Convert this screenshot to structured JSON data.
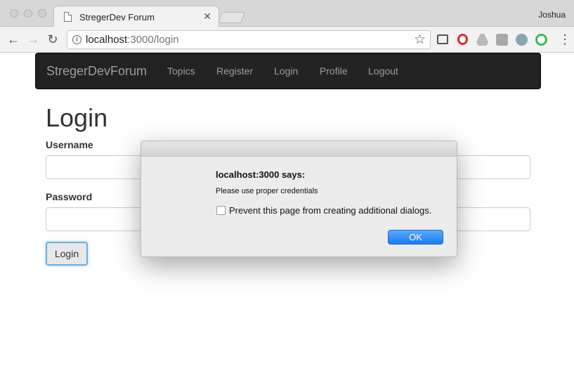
{
  "browser": {
    "tab_title": "StregerDev Forum",
    "tab_close": "✕",
    "profile_name": "Joshua",
    "url_host": "localhost",
    "url_path": ":3000/login",
    "icons": [
      "back-icon",
      "forward-icon",
      "reload-icon",
      "info-icon",
      "star-icon",
      "cast-icon",
      "opera-icon",
      "drive-icon",
      "extension-icon",
      "satellite-icon",
      "qr-icon",
      "menu-icon"
    ]
  },
  "navbar": {
    "brand": "StregerDevForum",
    "links": [
      "Topics",
      "Register",
      "Login",
      "Profile",
      "Logout"
    ]
  },
  "page": {
    "heading": "Login",
    "username_label": "Username",
    "username_value": "",
    "password_label": "Password",
    "password_value": "",
    "submit_label": "Login"
  },
  "dialog": {
    "title": "localhost:3000 says:",
    "message": "Please use proper credentials",
    "checkbox_label": "Prevent this page from creating additional dialogs.",
    "checkbox_checked": false,
    "ok_label": "OK"
  },
  "colors": {
    "navbar_bg": "#222222",
    "nav_text": "#9d9d9d",
    "ok_button": "#1a7df2",
    "focus_ring": "#66afe9"
  }
}
